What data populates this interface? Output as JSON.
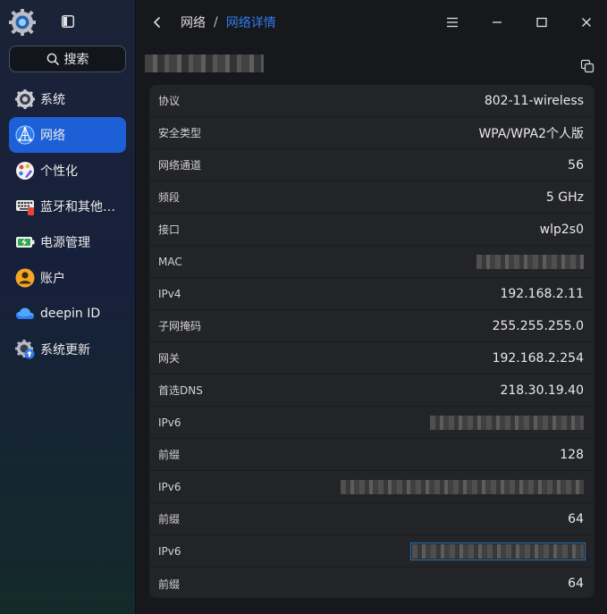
{
  "sidebar": {
    "search_label": "搜索",
    "items": [
      {
        "label": "系统",
        "icon": "system-icon",
        "active": false
      },
      {
        "label": "网络",
        "icon": "network-icon",
        "active": true
      },
      {
        "label": "个性化",
        "icon": "personalization-icon",
        "active": false
      },
      {
        "label": "蓝牙和其他…",
        "icon": "bluetooth-devices-icon",
        "active": false
      },
      {
        "label": "电源管理",
        "icon": "power-icon",
        "active": false
      },
      {
        "label": "账户",
        "icon": "account-icon",
        "active": false
      },
      {
        "label": "deepin ID",
        "icon": "cloud-icon",
        "active": false
      },
      {
        "label": "系统更新",
        "icon": "update-icon",
        "active": false
      }
    ]
  },
  "header": {
    "breadcrumb_parent": "网络",
    "breadcrumb_separator": "/",
    "breadcrumb_current": "网络详情"
  },
  "details": {
    "rows": [
      {
        "label": "协议",
        "value": "802-11-wireless"
      },
      {
        "label": "安全类型",
        "value": "WPA/WPA2个人版"
      },
      {
        "label": "网络通道",
        "value": "56"
      },
      {
        "label": "频段",
        "value": "5 GHz"
      },
      {
        "label": "接口",
        "value": "wlp2s0"
      },
      {
        "label": "MAC",
        "value": "",
        "redacted": true
      },
      {
        "label": "IPv4",
        "value": "192.168.2.11"
      },
      {
        "label": "子网掩码",
        "value": "255.255.255.0"
      },
      {
        "label": "网关",
        "value": "192.168.2.254"
      },
      {
        "label": "首选DNS",
        "value": "218.30.19.40"
      },
      {
        "label": "IPv6",
        "value": "",
        "redacted": true
      },
      {
        "label": "前缀",
        "value": "128"
      },
      {
        "label": "IPv6",
        "value": "",
        "redacted": true
      },
      {
        "label": "前缀",
        "value": "64"
      },
      {
        "label": "IPv6",
        "value": "",
        "redacted": true,
        "focused": true
      },
      {
        "label": "前缀",
        "value": "64"
      }
    ]
  },
  "colors": {
    "accent": "#1c5fd6",
    "breadcrumb_active": "#2f7bef",
    "panel": "#232427",
    "background": "#17181b"
  }
}
